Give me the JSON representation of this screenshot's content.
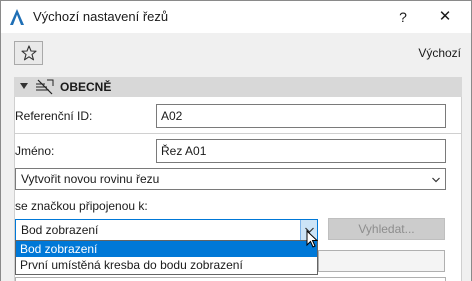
{
  "window": {
    "title": "Výchozí nastavení řezů",
    "help_label": "?",
    "close_label": "✕"
  },
  "toolbar": {
    "favorites_icon": "star-icon",
    "default_label": "Výchozí"
  },
  "section": {
    "title": "OBECNĚ",
    "icon": "section-tool-icon"
  },
  "fields": {
    "ref_id_label": "Referenční ID:",
    "ref_id_value": "A02",
    "name_label": "Jméno:",
    "name_value": "Řez A01",
    "mode_select_value": "Vytvořit novou rovinu řezu",
    "linked_label": "se značkou připojenou k:",
    "linked_select_value": "Bod zobrazení",
    "search_button": "Vyhledat..."
  },
  "dropdown": {
    "options": [
      "Bod zobrazení",
      "První umístěná kresba do bodu zobrazení"
    ],
    "selected_index": 0
  },
  "colors": {
    "accent": "#0078d7",
    "section_bg": "#d8d8d8",
    "disabled_button": "#cccccc"
  }
}
